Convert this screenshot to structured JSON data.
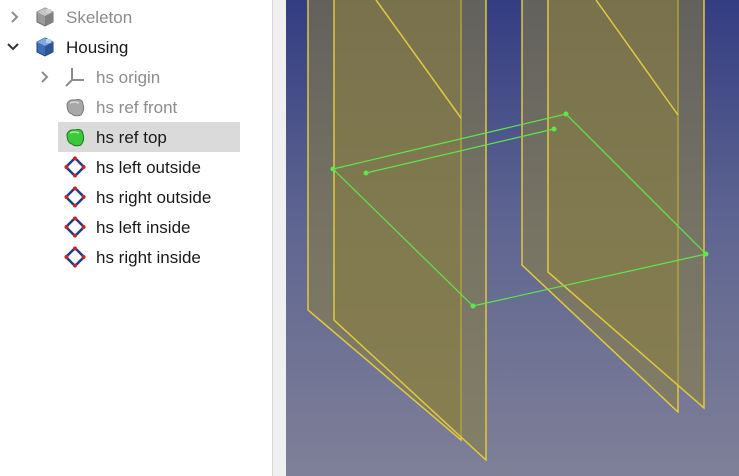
{
  "tree": {
    "items": [
      {
        "label": "Skeleton",
        "expander": "collapsed",
        "icon": "gray-body-icon",
        "dim": true
      },
      {
        "label": "Housing",
        "expander": "expanded",
        "icon": "blue-body-icon",
        "dim": false
      },
      {
        "label": "hs origin",
        "expander": "collapsed",
        "icon": "origin-axes-icon",
        "dim": true
      },
      {
        "label": "hs ref front",
        "expander": "none",
        "icon": "gray-shape-icon",
        "dim": true
      },
      {
        "label": "hs ref top",
        "expander": "none",
        "icon": "green-shape-icon",
        "dim": false,
        "selected": true
      },
      {
        "label": "hs left outside",
        "expander": "none",
        "icon": "sketch-icon",
        "dim": false
      },
      {
        "label": "hs right outside",
        "expander": "none",
        "icon": "sketch-icon",
        "dim": false
      },
      {
        "label": "hs left inside",
        "expander": "none",
        "icon": "sketch-icon",
        "dim": false
      },
      {
        "label": "hs right inside",
        "expander": "none",
        "icon": "sketch-icon",
        "dim": false
      }
    ]
  },
  "colors": {
    "plane_fill": "#8a8040",
    "plane_edge": "#e0c840",
    "sketch_line": "#5ce84a",
    "selection_bg": "#dadada"
  }
}
